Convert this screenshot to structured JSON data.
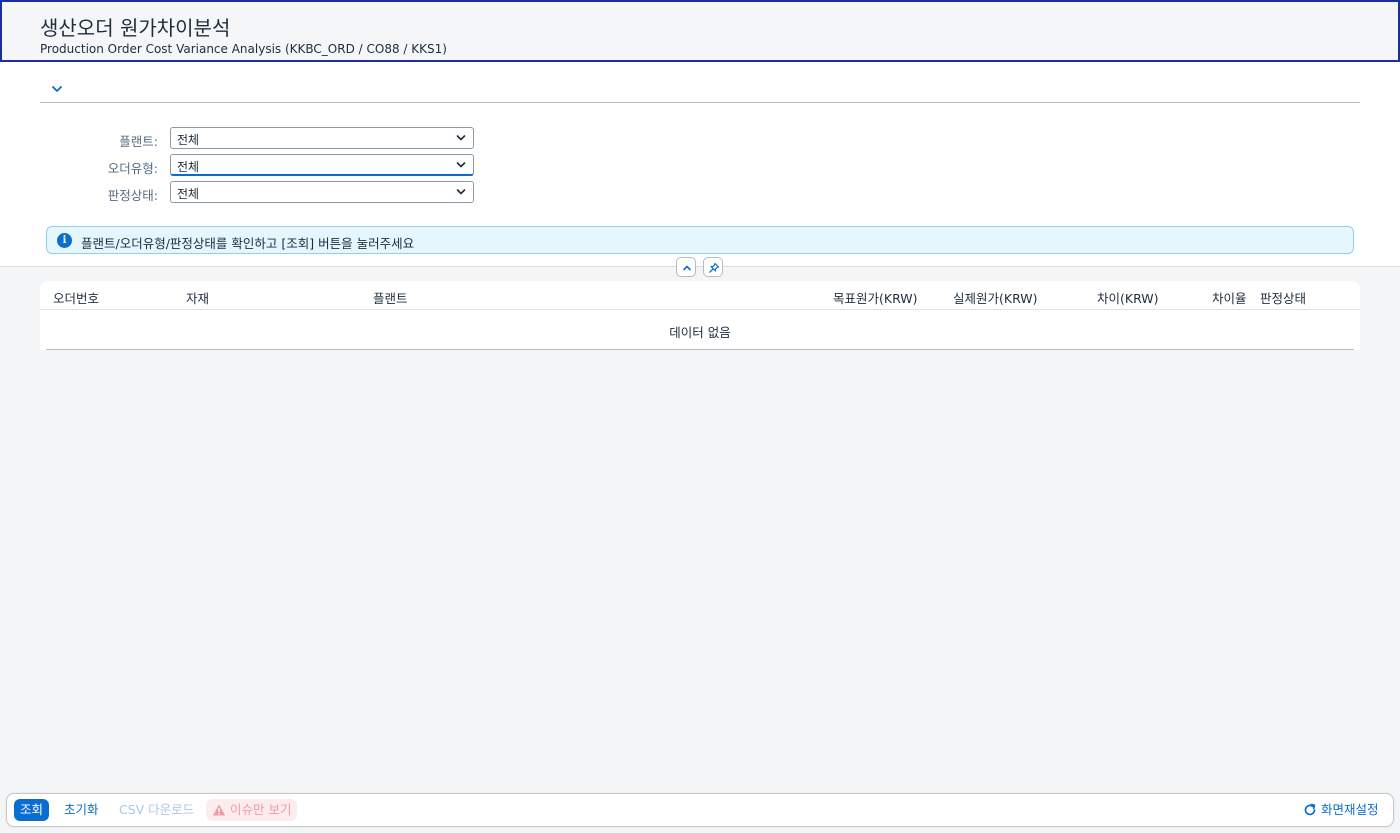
{
  "header": {
    "title": "생산오더 원가차이분석",
    "subtitle": "Production Order Cost Variance Analysis (KKBC_ORD / CO88 / KKS1)"
  },
  "filters": [
    {
      "label": "플랜트:",
      "value": "전체"
    },
    {
      "label": "오더유형:",
      "value": "전체"
    },
    {
      "label": "판정상태:",
      "value": "전체"
    }
  ],
  "info_message": "플랜트/오더유형/판정상태를 확인하고 [조회] 버튼을 눌러주세요",
  "table": {
    "columns": [
      "오더번호",
      "자재",
      "플랜트",
      "목표원가(KRW)",
      "실제원가(KRW)",
      "차이(KRW)",
      "차이율",
      "판정상태"
    ],
    "empty_text": "데이터 없음"
  },
  "footer": {
    "search": "조회",
    "reset": "초기화",
    "csv": "CSV 다운로드",
    "issues_only": "이슈만 보기",
    "reset_layout": "화면재설정"
  },
  "colors": {
    "accent": "#0a6ed1",
    "info_bg": "#e5f6fd",
    "header_border": "#1a2fa0"
  }
}
